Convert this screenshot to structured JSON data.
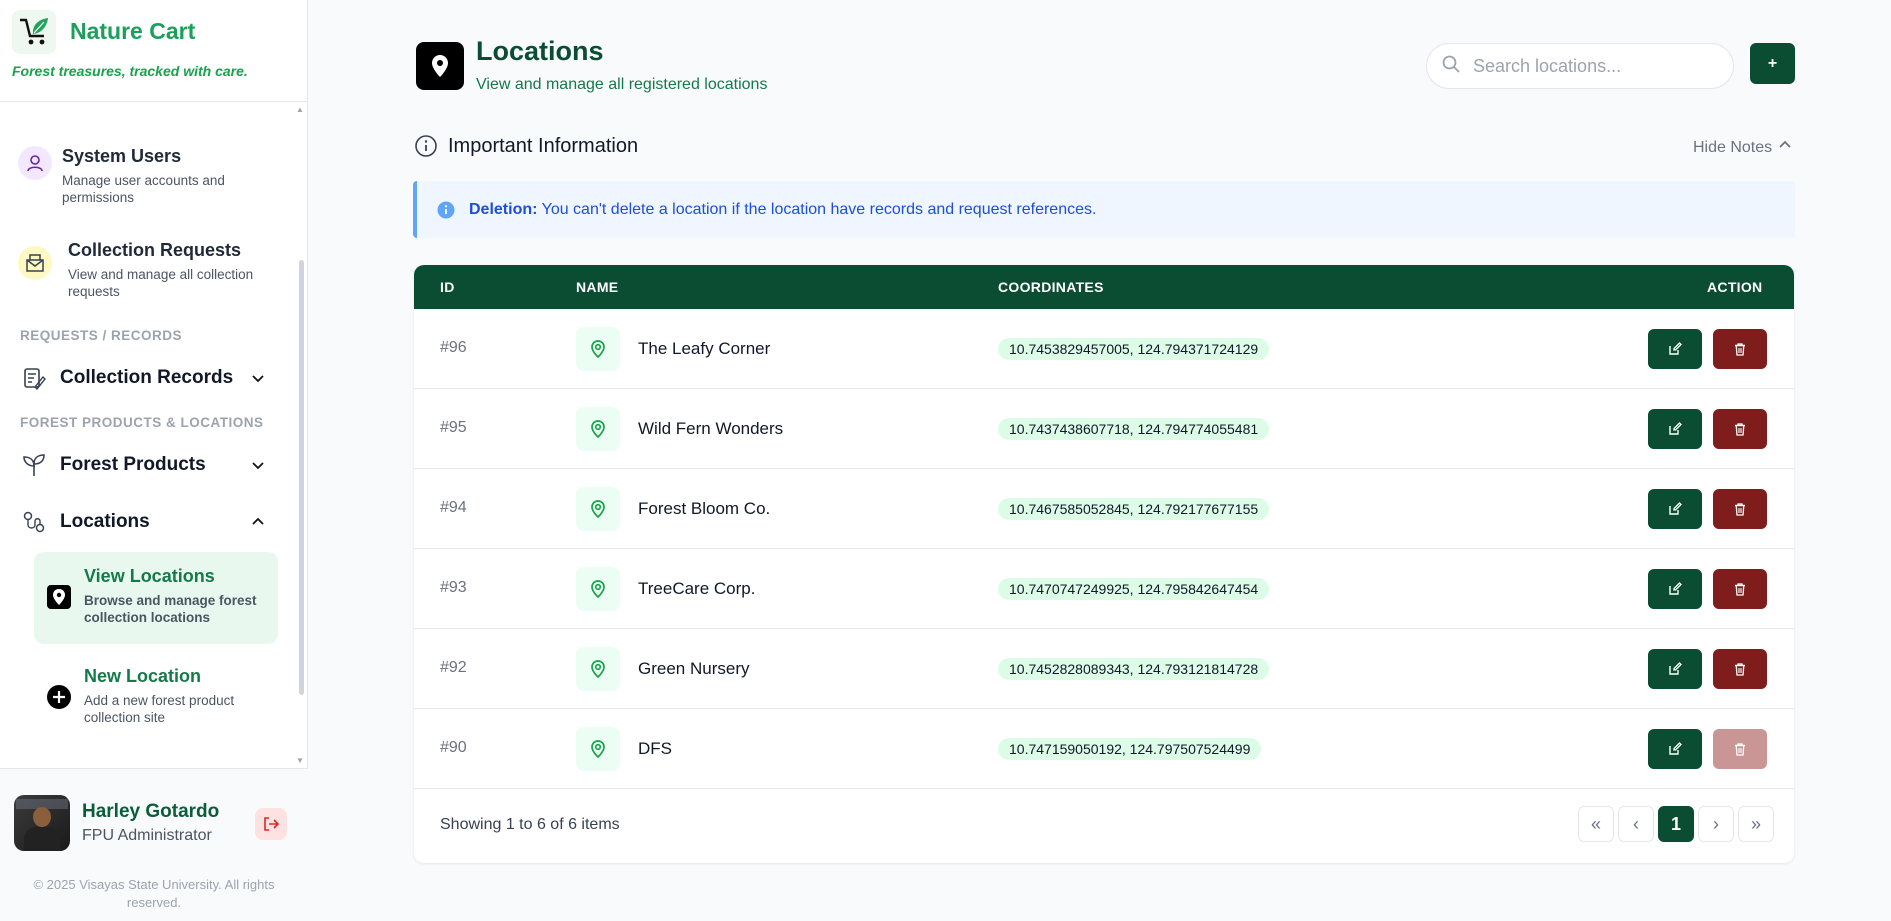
{
  "brand": {
    "name": "Nature Cart",
    "tagline": "Forest treasures, tracked with care."
  },
  "sidebar": {
    "cards": [
      {
        "title": "System Users",
        "desc": "Manage user accounts and permissions"
      },
      {
        "title": "Collection Requests",
        "desc": "View and manage all collection requests"
      }
    ],
    "sections": [
      {
        "label": "REQUESTS / RECORDS"
      },
      {
        "label": "FOREST PRODUCTS & LOCATIONS"
      }
    ],
    "groups": [
      {
        "label": "Collection Records",
        "expanded": false
      },
      {
        "label": "Forest Products",
        "expanded": false
      },
      {
        "label": "Locations",
        "expanded": true
      }
    ],
    "subitems": [
      {
        "title": "View Locations",
        "desc": "Browse and manage forest collection locations",
        "active": true
      },
      {
        "title": "New Location",
        "desc": "Add a new forest product collection site",
        "active": false
      }
    ]
  },
  "user": {
    "name": "Harley Gotardo",
    "role": "FPU Administrator"
  },
  "footer": {
    "copyright": "© 2025 Visayas State University. All rights reserved."
  },
  "header": {
    "title": "Locations",
    "subtitle": "View and manage all registered locations",
    "search_placeholder": "Search locations...",
    "add_label": "+"
  },
  "info": {
    "heading": "Important Information",
    "toggle_label": "Hide Notes",
    "notice_label": "Deletion:",
    "notice_text": "You can't delete a location if the location have records and request references."
  },
  "table": {
    "columns": [
      "ID",
      "NAME",
      "COORDINATES",
      "ACTION"
    ],
    "rows": [
      {
        "id": "#96",
        "name": "The Leafy Corner",
        "coordinates": "10.7453829457005, 124.794371724129",
        "deletable": true
      },
      {
        "id": "#95",
        "name": "Wild Fern Wonders",
        "coordinates": "10.7437438607718, 124.794774055481",
        "deletable": true
      },
      {
        "id": "#94",
        "name": "Forest Bloom Co.",
        "coordinates": "10.7467585052845, 124.792177677155",
        "deletable": true
      },
      {
        "id": "#93",
        "name": "TreeCare Corp.",
        "coordinates": "10.7470747249925, 124.795842647454",
        "deletable": true
      },
      {
        "id": "#92",
        "name": "Green Nursery",
        "coordinates": "10.7452828089343, 124.793121814728",
        "deletable": true
      },
      {
        "id": "#90",
        "name": "DFS",
        "coordinates": "10.747159050192, 124.797507524499",
        "deletable": false
      }
    ],
    "showing": "Showing 1 to 6 of 6 items",
    "pager": {
      "first": "«",
      "prev": "‹",
      "current": "1",
      "next": "›",
      "last": "»"
    }
  },
  "colors": {
    "primary": "#0b4d32",
    "danger": "#7f1d1d",
    "accent": "#1aa05a",
    "notice_bg": "#eff6ff"
  }
}
